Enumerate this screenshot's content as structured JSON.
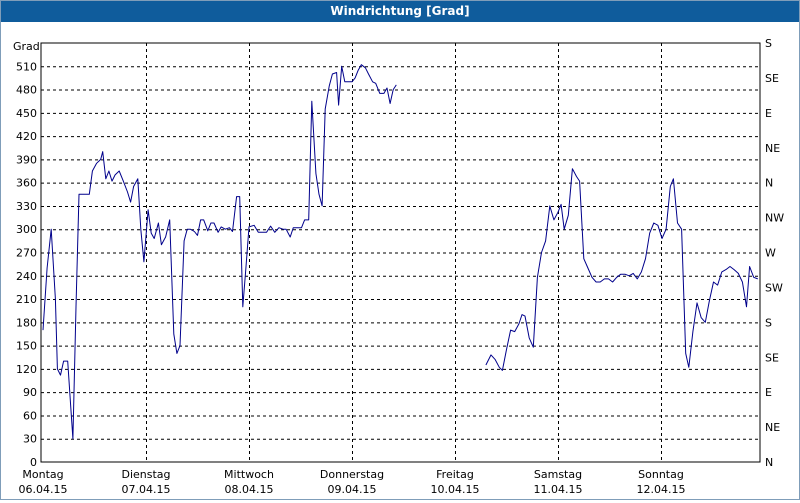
{
  "window": {
    "title": "Windrichtung [Grad]"
  },
  "chart_data": {
    "type": "line",
    "title": "Windrichtung [Grad]",
    "ylabel": "Grad",
    "ylim": [
      0,
      540
    ],
    "yticks": [
      0,
      30,
      60,
      90,
      120,
      150,
      180,
      210,
      240,
      270,
      300,
      330,
      360,
      390,
      420,
      450,
      480,
      510
    ],
    "right_axis_labels": [
      "N",
      "NE",
      "E",
      "SE",
      "S",
      "SW",
      "W",
      "NW",
      "N",
      "NE",
      "E",
      "SE",
      "S"
    ],
    "xlim": [
      0,
      7
    ],
    "xticks": [
      {
        "day": "Montag",
        "date": "06.04.15"
      },
      {
        "day": "Dienstag",
        "date": "07.04.15"
      },
      {
        "day": "Mittwoch",
        "date": "08.04.15"
      },
      {
        "day": "Donnerstag",
        "date": "09.04.15"
      },
      {
        "day": "Freitag",
        "date": "10.04.15"
      },
      {
        "day": "Samstag",
        "date": "11.04.15"
      },
      {
        "day": "Sonntag",
        "date": "12.04.15"
      }
    ],
    "grid": true,
    "line_color": "#00008b",
    "series": [
      {
        "segments": [
          [
            [
              0.0,
              170
            ],
            [
              0.04,
              250
            ],
            [
              0.08,
              300
            ],
            [
              0.12,
              210
            ],
            [
              0.14,
              120
            ],
            [
              0.17,
              112
            ],
            [
              0.2,
              130
            ],
            [
              0.24,
              130
            ],
            [
              0.27,
              70
            ],
            [
              0.29,
              30
            ],
            [
              0.32,
              200
            ],
            [
              0.35,
              345
            ],
            [
              0.4,
              345
            ],
            [
              0.45,
              345
            ],
            [
              0.48,
              375
            ],
            [
              0.52,
              385
            ],
            [
              0.56,
              390
            ],
            [
              0.58,
              400
            ],
            [
              0.61,
              365
            ],
            [
              0.64,
              375
            ],
            [
              0.67,
              362
            ],
            [
              0.7,
              370
            ],
            [
              0.74,
              375
            ],
            [
              0.78,
              362
            ],
            [
              0.82,
              348
            ],
            [
              0.85,
              335
            ],
            [
              0.88,
              355
            ],
            [
              0.92,
              365
            ],
            [
              0.95,
              300
            ],
            [
              0.98,
              258
            ],
            [
              1.02,
              325
            ],
            [
              1.05,
              295
            ],
            [
              1.08,
              288
            ],
            [
              1.12,
              308
            ],
            [
              1.15,
              280
            ],
            [
              1.19,
              290
            ],
            [
              1.23,
              312
            ],
            [
              1.27,
              165
            ],
            [
              1.3,
              140
            ],
            [
              1.33,
              150
            ],
            [
              1.37,
              285
            ],
            [
              1.4,
              300
            ],
            [
              1.43,
              300
            ],
            [
              1.47,
              297
            ],
            [
              1.5,
              292
            ],
            [
              1.53,
              312
            ],
            [
              1.56,
              312
            ],
            [
              1.6,
              298
            ],
            [
              1.63,
              308
            ],
            [
              1.66,
              308
            ],
            [
              1.7,
              296
            ],
            [
              1.73,
              303
            ],
            [
              1.77,
              300
            ],
            [
              1.81,
              302
            ],
            [
              1.84,
              297
            ],
            [
              1.88,
              342
            ],
            [
              1.91,
              342
            ],
            [
              1.94,
              200
            ],
            [
              1.97,
              250
            ],
            [
              2.0,
              303
            ],
            [
              2.05,
              305
            ],
            [
              2.09,
              296
            ],
            [
              2.13,
              296
            ],
            [
              2.17,
              296
            ],
            [
              2.21,
              304
            ],
            [
              2.25,
              296
            ],
            [
              2.29,
              302
            ],
            [
              2.33,
              300
            ],
            [
              2.36,
              300
            ],
            [
              2.4,
              290
            ],
            [
              2.43,
              302
            ],
            [
              2.47,
              302
            ],
            [
              2.51,
              302
            ],
            [
              2.54,
              312
            ],
            [
              2.58,
              312
            ],
            [
              2.61,
              465
            ],
            [
              2.65,
              372
            ],
            [
              2.68,
              345
            ],
            [
              2.71,
              330
            ],
            [
              2.74,
              455
            ],
            [
              2.78,
              485
            ],
            [
              2.81,
              500
            ],
            [
              2.85,
              502
            ],
            [
              2.87,
              460
            ],
            [
              2.9,
              510
            ],
            [
              2.93,
              490
            ],
            [
              2.96,
              490
            ],
            [
              3.0,
              490
            ],
            [
              3.03,
              495
            ],
            [
              3.06,
              505
            ],
            [
              3.09,
              512
            ],
            [
              3.13,
              508
            ],
            [
              3.16,
              500
            ],
            [
              3.2,
              490
            ],
            [
              3.23,
              488
            ],
            [
              3.27,
              475
            ],
            [
              3.31,
              475
            ],
            [
              3.34,
              482
            ],
            [
              3.37,
              462
            ],
            [
              3.4,
              480
            ],
            [
              3.43,
              486
            ]
          ],
          [
            [
              4.3,
              125
            ],
            [
              4.35,
              138
            ],
            [
              4.39,
              132
            ],
            [
              4.43,
              122
            ],
            [
              4.46,
              118
            ],
            [
              4.5,
              145
            ],
            [
              4.54,
              170
            ],
            [
              4.58,
              168
            ],
            [
              4.62,
              178
            ],
            [
              4.65,
              190
            ],
            [
              4.68,
              188
            ],
            [
              4.72,
              160
            ],
            [
              4.76,
              148
            ],
            [
              4.8,
              238
            ],
            [
              4.84,
              270
            ],
            [
              4.88,
              285
            ],
            [
              4.92,
              330
            ],
            [
              4.96,
              312
            ],
            [
              5.0,
              322
            ],
            [
              5.03,
              332
            ],
            [
              5.06,
              300
            ],
            [
              5.1,
              318
            ],
            [
              5.14,
              378
            ],
            [
              5.18,
              368
            ],
            [
              5.21,
              362
            ],
            [
              5.25,
              262
            ],
            [
              5.29,
              250
            ],
            [
              5.33,
              238
            ],
            [
              5.37,
              232
            ],
            [
              5.41,
              232
            ],
            [
              5.45,
              236
            ],
            [
              5.49,
              236
            ],
            [
              5.53,
              232
            ],
            [
              5.57,
              238
            ],
            [
              5.61,
              242
            ],
            [
              5.65,
              242
            ],
            [
              5.69,
              240
            ],
            [
              5.73,
              243
            ],
            [
              5.77,
              236
            ],
            [
              5.81,
              245
            ],
            [
              5.85,
              262
            ],
            [
              5.89,
              295
            ],
            [
              5.93,
              308
            ],
            [
              5.97,
              305
            ],
            [
              6.01,
              288
            ],
            [
              6.05,
              300
            ],
            [
              6.09,
              355
            ],
            [
              6.12,
              365
            ],
            [
              6.16,
              308
            ],
            [
              6.2,
              300
            ],
            [
              6.24,
              140
            ],
            [
              6.27,
              122
            ],
            [
              6.31,
              168
            ],
            [
              6.35,
              205
            ],
            [
              6.39,
              186
            ],
            [
              6.43,
              180
            ],
            [
              6.47,
              208
            ],
            [
              6.51,
              232
            ],
            [
              6.55,
              228
            ],
            [
              6.59,
              245
            ],
            [
              6.63,
              248
            ],
            [
              6.67,
              252
            ],
            [
              6.71,
              248
            ],
            [
              6.75,
              243
            ],
            [
              6.79,
              232
            ],
            [
              6.83,
              200
            ],
            [
              6.86,
              252
            ],
            [
              6.9,
              238
            ],
            [
              6.94,
              236
            ]
          ]
        ]
      }
    ]
  }
}
